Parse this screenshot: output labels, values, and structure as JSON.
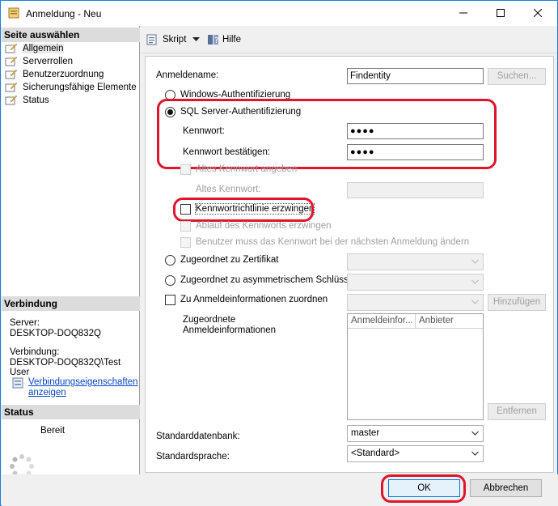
{
  "window": {
    "title": "Anmeldung - Neu",
    "accent": "#1a7fd6",
    "highlight_color": "#e0142a",
    "controls": [
      "minimize-icon",
      "maximize-icon",
      "close-icon"
    ]
  },
  "sidebar": {
    "pages_heading": "Seite auswählen",
    "pages": [
      {
        "label": "Allgemein",
        "selected": true
      },
      {
        "label": "Serverrollen",
        "selected": false
      },
      {
        "label": "Benutzerzuordnung",
        "selected": false
      },
      {
        "label": "Sicherungsfähige Elemente",
        "selected": false
      },
      {
        "label": "Status",
        "selected": false
      }
    ],
    "connection_heading": "Verbindung",
    "server_label": "Server:",
    "server_value": "DESKTOP-DOQ832Q",
    "connection_label": "Verbindung:",
    "connection_value": "DESKTOP-DOQ832Q\\Test User",
    "connection_link_line1": "Verbindungseigenschaften",
    "connection_link_line2": "anzeigen",
    "status_heading": "Status",
    "status_value": "Bereit"
  },
  "toolbar": {
    "script_label": "Skript",
    "help_label": "Hilfe"
  },
  "form": {
    "login_name_label": "Anmeldename:",
    "login_name_value": "Findentity",
    "search_button": "Suchen...",
    "windows_auth_label": "Windows-Authentifizierung",
    "sql_auth_label": "SQL Server-Authentifizierung",
    "sql_auth_selected": true,
    "password_label": "Kennwort:",
    "password_value": "●●●●",
    "confirm_password_label": "Kennwort bestätigen:",
    "confirm_password_value": "●●●●",
    "old_password_check_label": "Altes Kennwort angeben",
    "old_password_label": "Altes Kennwort:",
    "enforce_policy_label": "Kennwortrichtlinie erzwingen",
    "enforce_expiration_label": "Ablauf des Kennworts erzwingen",
    "must_change_label": "Benutzer muss das Kennwort bei der nächsten Anmeldung ändern",
    "certificate_label": "Zugeordnet zu Zertifikat",
    "asym_key_label": "Zugeordnet zu asymmetrischem Schlüssel",
    "map_credentials_label": "Zu Anmeldeinformationen zuordnen",
    "add_button": "Hinzufügen",
    "mapped_credentials_line1": "Zugeordnete",
    "mapped_credentials_line2": "Anmeldeinformationen",
    "grid_columns": [
      "Anmeldeinfor...",
      "Anbieter"
    ],
    "remove_button": "Entfernen",
    "default_db_label": "Standarddatenbank:",
    "default_db_value": "master",
    "default_lang_label": "Standardsprache:",
    "default_lang_value": "<Standard>"
  },
  "footer": {
    "ok_button": "OK",
    "cancel_button": "Abbrechen"
  }
}
